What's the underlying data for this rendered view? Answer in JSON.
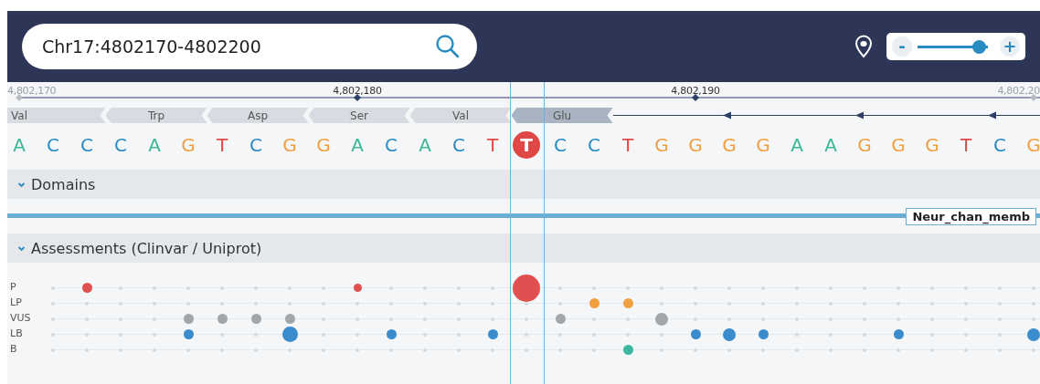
{
  "search": {
    "value": "Chr17:4802170-4802200"
  },
  "zoom": {
    "minus": "-",
    "plus": "+",
    "level": 0.88
  },
  "ruler": {
    "ticks": [
      {
        "label": "4,802,170",
        "muted": true
      },
      {
        "label": "4,802,180",
        "muted": false
      },
      {
        "label": "4,802,190",
        "muted": false
      },
      {
        "label": "4,802,20",
        "muted": true
      }
    ]
  },
  "amino_acids": [
    {
      "label": "Val",
      "selected": false
    },
    {
      "label": "Trp",
      "selected": false
    },
    {
      "label": "Asp",
      "selected": false
    },
    {
      "label": "Ser",
      "selected": false
    },
    {
      "label": "Val",
      "selected": false
    },
    {
      "label": "Glu",
      "selected": true
    }
  ],
  "bases": [
    {
      "letter": "A",
      "color": "#3cb896",
      "selected": false
    },
    {
      "letter": "C",
      "color": "#2a8bc0",
      "selected": false
    },
    {
      "letter": "C",
      "color": "#2a8bc0",
      "selected": false
    },
    {
      "letter": "C",
      "color": "#2a8bc0",
      "selected": false
    },
    {
      "letter": "A",
      "color": "#3cb896",
      "selected": false
    },
    {
      "letter": "G",
      "color": "#f0a040",
      "selected": false
    },
    {
      "letter": "T",
      "color": "#e04848",
      "selected": false
    },
    {
      "letter": "C",
      "color": "#2a8bc0",
      "selected": false
    },
    {
      "letter": "G",
      "color": "#f0a040",
      "selected": false
    },
    {
      "letter": "G",
      "color": "#f0a040",
      "selected": false
    },
    {
      "letter": "A",
      "color": "#3cb896",
      "selected": false
    },
    {
      "letter": "C",
      "color": "#2a8bc0",
      "selected": false
    },
    {
      "letter": "A",
      "color": "#3cb896",
      "selected": false
    },
    {
      "letter": "C",
      "color": "#2a8bc0",
      "selected": false
    },
    {
      "letter": "T",
      "color": "#e04848",
      "selected": false
    },
    {
      "letter": "T",
      "color": "#e04848",
      "selected": true
    },
    {
      "letter": "C",
      "color": "#2a8bc0",
      "selected": false
    },
    {
      "letter": "C",
      "color": "#2a8bc0",
      "selected": false
    },
    {
      "letter": "T",
      "color": "#e04848",
      "selected": false
    },
    {
      "letter": "G",
      "color": "#f0a040",
      "selected": false
    },
    {
      "letter": "G",
      "color": "#f0a040",
      "selected": false
    },
    {
      "letter": "G",
      "color": "#f0a040",
      "selected": false
    },
    {
      "letter": "G",
      "color": "#f0a040",
      "selected": false
    },
    {
      "letter": "A",
      "color": "#3cb896",
      "selected": false
    },
    {
      "letter": "A",
      "color": "#3cb896",
      "selected": false
    },
    {
      "letter": "G",
      "color": "#f0a040",
      "selected": false
    },
    {
      "letter": "G",
      "color": "#f0a040",
      "selected": false
    },
    {
      "letter": "G",
      "color": "#f0a040",
      "selected": false
    },
    {
      "letter": "T",
      "color": "#e04848",
      "selected": false
    },
    {
      "letter": "C",
      "color": "#2a8bc0",
      "selected": false
    },
    {
      "letter": "G",
      "color": "#f0a040",
      "selected": false
    }
  ],
  "domains": {
    "title": "Domains",
    "expanded": true,
    "label": "Neur_chan_memb"
  },
  "assessments": {
    "title": "Assessments (Clinvar / Uniprot)",
    "expanded": true,
    "rows": [
      {
        "label": "P",
        "color": "#e05050",
        "cells": [
          {
            "kind": "blank"
          },
          {
            "kind": "empty"
          },
          {
            "kind": "medium"
          },
          {
            "kind": "empty"
          },
          {
            "kind": "empty"
          },
          {
            "kind": "empty"
          },
          {
            "kind": "empty"
          },
          {
            "kind": "empty"
          },
          {
            "kind": "empty"
          },
          {
            "kind": "empty"
          },
          {
            "kind": "small"
          },
          {
            "kind": "empty"
          },
          {
            "kind": "empty"
          },
          {
            "kind": "empty"
          },
          {
            "kind": "empty"
          },
          {
            "kind": "huge"
          },
          {
            "kind": "empty"
          },
          {
            "kind": "empty"
          },
          {
            "kind": "empty"
          },
          {
            "kind": "empty"
          },
          {
            "kind": "empty"
          },
          {
            "kind": "empty"
          },
          {
            "kind": "empty"
          },
          {
            "kind": "empty"
          },
          {
            "kind": "empty"
          },
          {
            "kind": "empty"
          },
          {
            "kind": "empty"
          },
          {
            "kind": "empty"
          },
          {
            "kind": "empty"
          },
          {
            "kind": "empty"
          },
          {
            "kind": "empty"
          }
        ]
      },
      {
        "label": "LP",
        "color": "#f0a040",
        "cells": [
          {
            "kind": "blank"
          },
          {
            "kind": "empty"
          },
          {
            "kind": "empty"
          },
          {
            "kind": "empty"
          },
          {
            "kind": "empty"
          },
          {
            "kind": "empty"
          },
          {
            "kind": "empty"
          },
          {
            "kind": "empty"
          },
          {
            "kind": "empty"
          },
          {
            "kind": "empty"
          },
          {
            "kind": "empty"
          },
          {
            "kind": "empty"
          },
          {
            "kind": "empty"
          },
          {
            "kind": "empty"
          },
          {
            "kind": "empty"
          },
          {
            "kind": "empty"
          },
          {
            "kind": "empty"
          },
          {
            "kind": "medium"
          },
          {
            "kind": "medium"
          },
          {
            "kind": "empty"
          },
          {
            "kind": "empty"
          },
          {
            "kind": "empty"
          },
          {
            "kind": "empty"
          },
          {
            "kind": "empty"
          },
          {
            "kind": "empty"
          },
          {
            "kind": "empty"
          },
          {
            "kind": "empty"
          },
          {
            "kind": "empty"
          },
          {
            "kind": "empty"
          },
          {
            "kind": "empty"
          },
          {
            "kind": "empty"
          }
        ]
      },
      {
        "label": "VUS",
        "color": "#a0a6aa",
        "cells": [
          {
            "kind": "blank"
          },
          {
            "kind": "empty"
          },
          {
            "kind": "empty"
          },
          {
            "kind": "empty"
          },
          {
            "kind": "empty"
          },
          {
            "kind": "medium"
          },
          {
            "kind": "medium"
          },
          {
            "kind": "medium"
          },
          {
            "kind": "medium"
          },
          {
            "kind": "empty"
          },
          {
            "kind": "empty"
          },
          {
            "kind": "empty"
          },
          {
            "kind": "empty"
          },
          {
            "kind": "empty"
          },
          {
            "kind": "empty"
          },
          {
            "kind": "empty"
          },
          {
            "kind": "medium"
          },
          {
            "kind": "empty"
          },
          {
            "kind": "empty"
          },
          {
            "kind": "large"
          },
          {
            "kind": "empty"
          },
          {
            "kind": "empty"
          },
          {
            "kind": "empty"
          },
          {
            "kind": "empty"
          },
          {
            "kind": "empty"
          },
          {
            "kind": "empty"
          },
          {
            "kind": "empty"
          },
          {
            "kind": "empty"
          },
          {
            "kind": "empty"
          },
          {
            "kind": "empty"
          },
          {
            "kind": "empty"
          }
        ]
      },
      {
        "label": "LB",
        "color": "#3a8ccc",
        "cells": [
          {
            "kind": "blank"
          },
          {
            "kind": "empty"
          },
          {
            "kind": "empty"
          },
          {
            "kind": "empty"
          },
          {
            "kind": "empty"
          },
          {
            "kind": "medium"
          },
          {
            "kind": "empty"
          },
          {
            "kind": "empty"
          },
          {
            "kind": "xlarge"
          },
          {
            "kind": "empty"
          },
          {
            "kind": "empty"
          },
          {
            "kind": "medium"
          },
          {
            "kind": "empty"
          },
          {
            "kind": "empty"
          },
          {
            "kind": "medium"
          },
          {
            "kind": "empty"
          },
          {
            "kind": "empty"
          },
          {
            "kind": "empty"
          },
          {
            "kind": "empty"
          },
          {
            "kind": "empty"
          },
          {
            "kind": "medium"
          },
          {
            "kind": "large"
          },
          {
            "kind": "medium"
          },
          {
            "kind": "empty"
          },
          {
            "kind": "empty"
          },
          {
            "kind": "empty"
          },
          {
            "kind": "medium"
          },
          {
            "kind": "empty"
          },
          {
            "kind": "empty"
          },
          {
            "kind": "empty"
          },
          {
            "kind": "large"
          }
        ]
      },
      {
        "label": "B",
        "color": "#3cb8a0",
        "cells": [
          {
            "kind": "blank"
          },
          {
            "kind": "empty"
          },
          {
            "kind": "empty"
          },
          {
            "kind": "empty"
          },
          {
            "kind": "empty"
          },
          {
            "kind": "empty"
          },
          {
            "kind": "empty"
          },
          {
            "kind": "empty"
          },
          {
            "kind": "empty"
          },
          {
            "kind": "empty"
          },
          {
            "kind": "empty"
          },
          {
            "kind": "empty"
          },
          {
            "kind": "empty"
          },
          {
            "kind": "empty"
          },
          {
            "kind": "empty"
          },
          {
            "kind": "empty"
          },
          {
            "kind": "empty"
          },
          {
            "kind": "empty"
          },
          {
            "kind": "medium"
          },
          {
            "kind": "empty"
          },
          {
            "kind": "empty"
          },
          {
            "kind": "empty"
          },
          {
            "kind": "empty"
          },
          {
            "kind": "empty"
          },
          {
            "kind": "empty"
          },
          {
            "kind": "empty"
          },
          {
            "kind": "empty"
          },
          {
            "kind": "empty"
          },
          {
            "kind": "empty"
          },
          {
            "kind": "empty"
          },
          {
            "kind": "empty"
          }
        ]
      }
    ]
  }
}
